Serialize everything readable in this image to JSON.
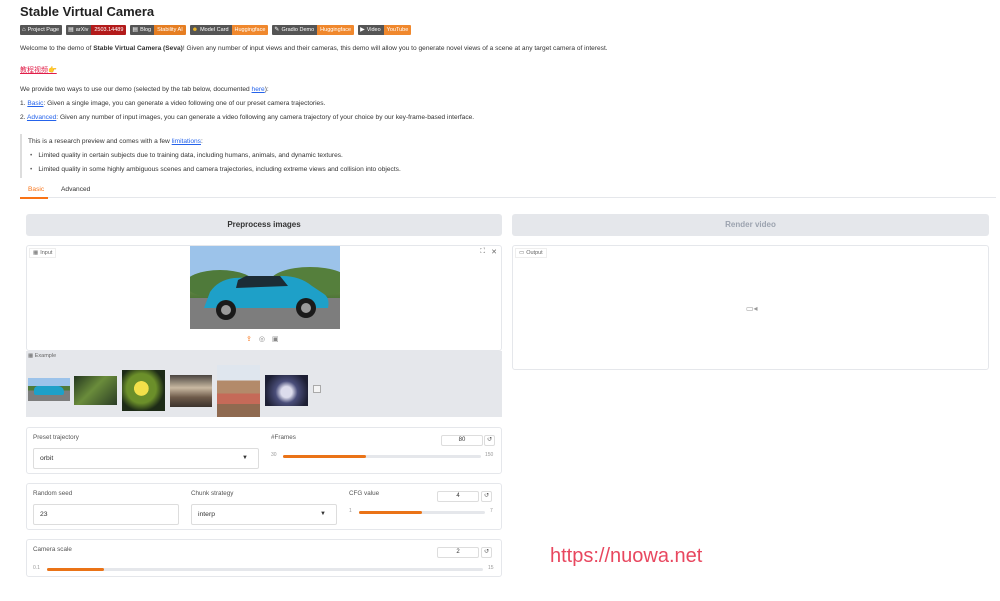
{
  "title": "Stable Virtual Camera",
  "badges": [
    {
      "left": "Project Page",
      "right": "",
      "color": "",
      "icon": "home-icon"
    },
    {
      "left": "arXiv",
      "right": "2503.14489",
      "color": "#b31b1b",
      "icon": "doc-icon"
    },
    {
      "left": "Blog",
      "right": "Stability AI",
      "color": "#e67e22",
      "icon": "doc-icon"
    },
    {
      "left": "Model Card",
      "right": "Huggingface",
      "color": "#f0882d",
      "icon": "hf-icon"
    },
    {
      "left": "Gradio Demo",
      "right": "Huggingface",
      "color": "#f0882d",
      "icon": "gradio-icon"
    },
    {
      "left": "Video",
      "right": "YouTube",
      "color": "#f0882d",
      "icon": "video-icon"
    }
  ],
  "intro": {
    "pre": "Welcome to the demo of ",
    "bold": "Stable Virtual Camera (Seva)",
    "post": "! Given any number of input views and their cameras, this demo will allow you to generate novel views of a scene at any target camera of interest."
  },
  "red_link": "教程视频👉",
  "ways": {
    "pre": "We provide two ways to use our demo (selected by the tab below, documented ",
    "link": "here",
    "post": "):"
  },
  "basic_line": {
    "num": "1. ",
    "link": "Basic",
    "text": ": Given a single image, you can generate a video following one of our preset camera trajectories."
  },
  "advanced_line": {
    "num": "2. ",
    "link": "Advanced",
    "text": ": Given any number of input images, you can generate a video following any camera trajectory of your choice by our key-frame-based interface."
  },
  "notice": {
    "pre": "This is a research preview and comes with a few ",
    "link": "limitations",
    "post": ":",
    "items": [
      "Limited quality in certain subjects due to training data, including humans, animals, and dynamic textures.",
      "Limited quality in some highly ambiguous scenes and camera trajectories, including extreme views and collision into objects."
    ]
  },
  "tabs": [
    "Basic",
    "Advanced"
  ],
  "buttons": {
    "preprocess": "Preprocess images",
    "render": "Render video"
  },
  "input_label": "Input",
  "output_label": "Output",
  "example_label": "Example",
  "preset_trajectory": {
    "label": "Preset trajectory",
    "value": "orbit"
  },
  "frames": {
    "label": "#Frames",
    "value": "80",
    "min": "30",
    "max": "150",
    "fraction": 0.42
  },
  "seed": {
    "label": "Random seed",
    "value": "23"
  },
  "chunk": {
    "label": "Chunk strategy",
    "value": "interp"
  },
  "cfg": {
    "label": "CFG value",
    "value": "4",
    "min": "1",
    "max": "7",
    "fraction": 0.5
  },
  "camera_scale": {
    "label": "Camera scale",
    "value": "2",
    "min": "0.1",
    "max": "15",
    "fraction": 0.13
  },
  "watermark": "https://nuowa.net"
}
